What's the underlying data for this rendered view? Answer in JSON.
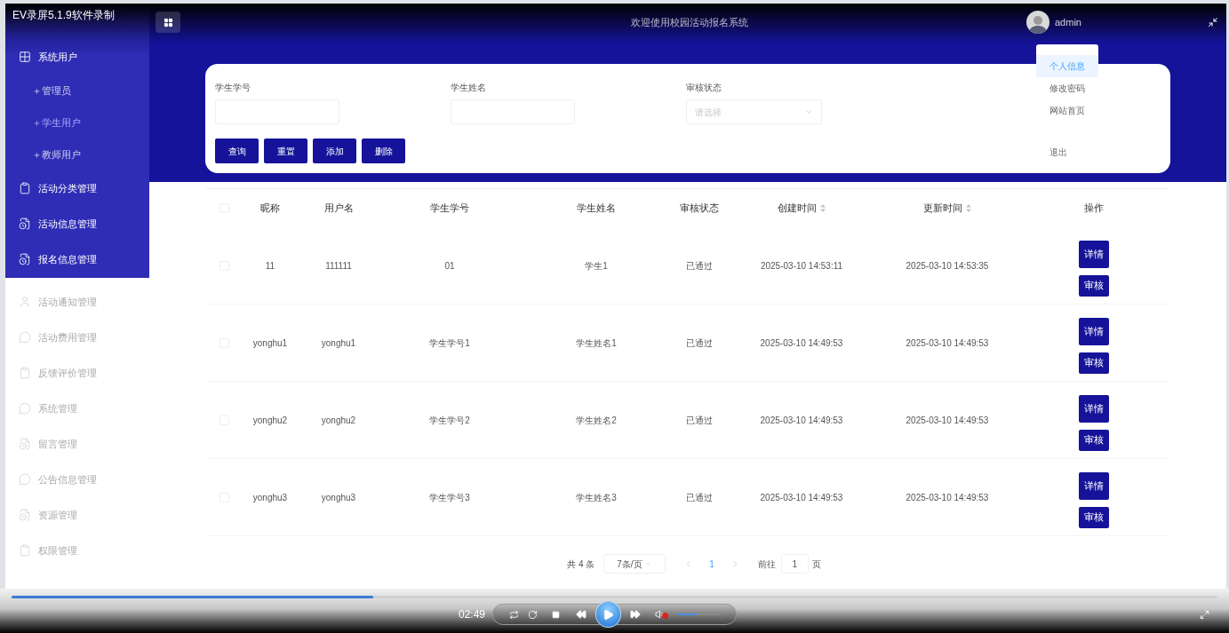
{
  "recorder": {
    "title": "EV录屏5.1.9软件录制"
  },
  "sidebar": {
    "primary_items": [
      {
        "label": "系统用户",
        "selected": false,
        "expanded": true,
        "children": [
          {
            "label": "＋管理员",
            "selected": false
          },
          {
            "label": "＋学生用户",
            "selected": true
          },
          {
            "label": "＋教师用户",
            "selected": false
          }
        ]
      },
      {
        "label": "活动分类管理",
        "selected": false
      },
      {
        "label": "活动信息管理",
        "selected": false
      },
      {
        "label": "报名信息管理",
        "selected": false
      }
    ],
    "secondary_items": [
      {
        "label": "活动通知管理"
      },
      {
        "label": "活动费用管理"
      },
      {
        "label": "反馈评价管理"
      },
      {
        "label": "系统管理"
      },
      {
        "label": "留言管理"
      },
      {
        "label": "公告信息管理"
      },
      {
        "label": "资源管理"
      },
      {
        "label": "权限管理"
      }
    ]
  },
  "header": {
    "title": "欢迎使用校园活动报名系统",
    "user": "admin"
  },
  "user_menu": [
    {
      "label": "个人信息",
      "selected": true
    },
    {
      "label": "修改密码",
      "selected": false
    },
    {
      "label": "网站首页",
      "selected": false
    },
    {
      "label": "退出",
      "selected": false
    }
  ],
  "search": {
    "fields": [
      {
        "label": "学生学号",
        "kind": "input"
      },
      {
        "label": "学生姓名",
        "kind": "input"
      },
      {
        "label": "审核状态",
        "kind": "select",
        "placeholder": "请选择"
      }
    ],
    "buttons": [
      "查询",
      "重置",
      "添加",
      "删除"
    ]
  },
  "table": {
    "all_checked": false,
    "columns": [
      {
        "label": "昵称",
        "sortable": false
      },
      {
        "label": "用户名",
        "sortable": false
      },
      {
        "label": "学生学号",
        "sortable": false
      },
      {
        "label": "学生姓名",
        "sortable": false
      },
      {
        "label": "审核状态",
        "sortable": false
      },
      {
        "label": "创建时间",
        "sortable": true
      },
      {
        "label": "更新时间",
        "sortable": true
      },
      {
        "label": "操作",
        "sortable": false
      }
    ],
    "rows": [
      {
        "checked": false,
        "cells": [
          "11",
          "111111",
          "01",
          "学生1",
          "已通过",
          "2025-03-10 14:53:11",
          "2025-03-10 14:53:35"
        ],
        "actions": [
          "详情",
          "审核"
        ]
      },
      {
        "checked": false,
        "cells": [
          "yonghu1",
          "yonghu1",
          "学生学号1",
          "学生姓名1",
          "已通过",
          "2025-03-10 14:49:53",
          "2025-03-10 14:49:53"
        ],
        "actions": [
          "详情",
          "审核"
        ]
      },
      {
        "checked": false,
        "cells": [
          "yonghu2",
          "yonghu2",
          "学生学号2",
          "学生姓名2",
          "已通过",
          "2025-03-10 14:49:53",
          "2025-03-10 14:49:53"
        ],
        "actions": [
          "详情",
          "审核"
        ]
      },
      {
        "checked": false,
        "cells": [
          "yonghu3",
          "yonghu3",
          "学生学号3",
          "学生姓名3",
          "已通过",
          "2025-03-10 14:49:53",
          "2025-03-10 14:49:53"
        ],
        "actions": [
          "详情",
          "审核"
        ]
      }
    ]
  },
  "pagination": {
    "total": "共 4 条",
    "page_size": "7条/页",
    "pages": [
      {
        "label": "1",
        "selected": true
      }
    ],
    "goto_label": "前往",
    "goto_value": "1",
    "goto_suffix": "页"
  },
  "player": {
    "time": "02:49",
    "progress": {
      "level": 0.3
    },
    "muted": true,
    "volume": {
      "level": 0.45
    }
  }
}
